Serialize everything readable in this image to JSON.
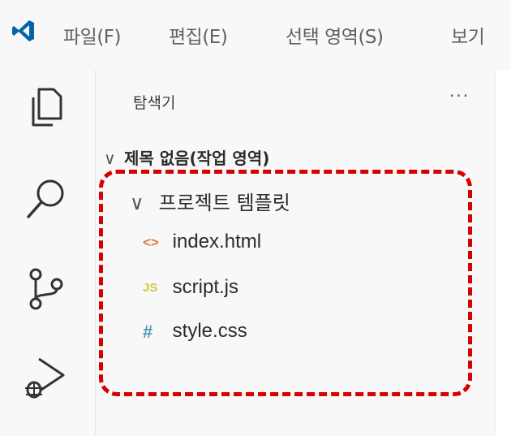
{
  "menubar": {
    "items": [
      "파일(F)",
      "편집(E)",
      "선택 영역(S)",
      "보기"
    ]
  },
  "activity_bar": {
    "icons": [
      "explorer-icon",
      "search-icon",
      "source-control-icon",
      "run-debug-icon"
    ]
  },
  "explorer": {
    "title": "탐색기",
    "more": "···",
    "workspace": "제목 없음(작업 영역)",
    "folder": "프로젝트 템플릿",
    "files": [
      {
        "icon": "<>",
        "name": "index.html",
        "icon_color": "#e37933"
      },
      {
        "icon": "JS",
        "name": "script.js",
        "icon_color": "#cbcb41"
      },
      {
        "icon": "#",
        "name": "style.css",
        "icon_color": "#519aba"
      }
    ]
  },
  "colors": {
    "highlight": "#d70000",
    "vscode_blue": "#0065a9"
  }
}
